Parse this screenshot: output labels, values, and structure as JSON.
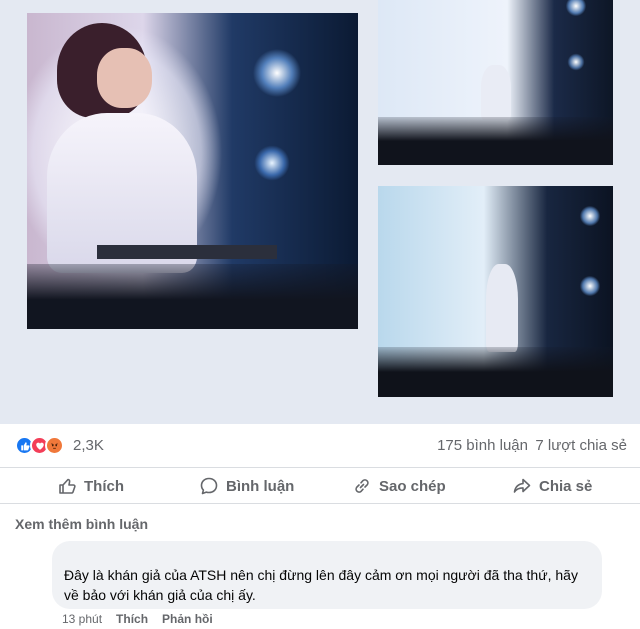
{
  "post": {
    "photos": [
      {
        "name": "concert-photo-closeup"
      },
      {
        "name": "concert-photo-stage-top"
      },
      {
        "name": "concert-photo-stage-bottom"
      }
    ]
  },
  "reactions": {
    "icons": [
      "like-icon",
      "love-icon",
      "angry-icon"
    ],
    "count": "2,3K",
    "comments": "175 bình luận",
    "shares": "7 lượt chia sẻ"
  },
  "actions": {
    "like": "Thích",
    "comment": "Bình luận",
    "copy": "Sao chép",
    "share": "Chia sẻ"
  },
  "comments_section": {
    "more_label": "Xem thêm bình luận",
    "items": [
      {
        "text": "Đây là khán giả của ATSH nên chị đừng lên đây cảm ơn mọi người đã tha thứ, hãy về bảo với khán giả của chị ấy.",
        "time": "13 phút",
        "like_label": "Thích",
        "reply_label": "Phản hồi"
      }
    ]
  },
  "colors": {
    "like_blue": "#1877f2",
    "love_red": "#f33e58",
    "angry_orange": "#f0783a",
    "secondary_text": "#65676b",
    "bubble_bg": "#f0f2f5"
  }
}
